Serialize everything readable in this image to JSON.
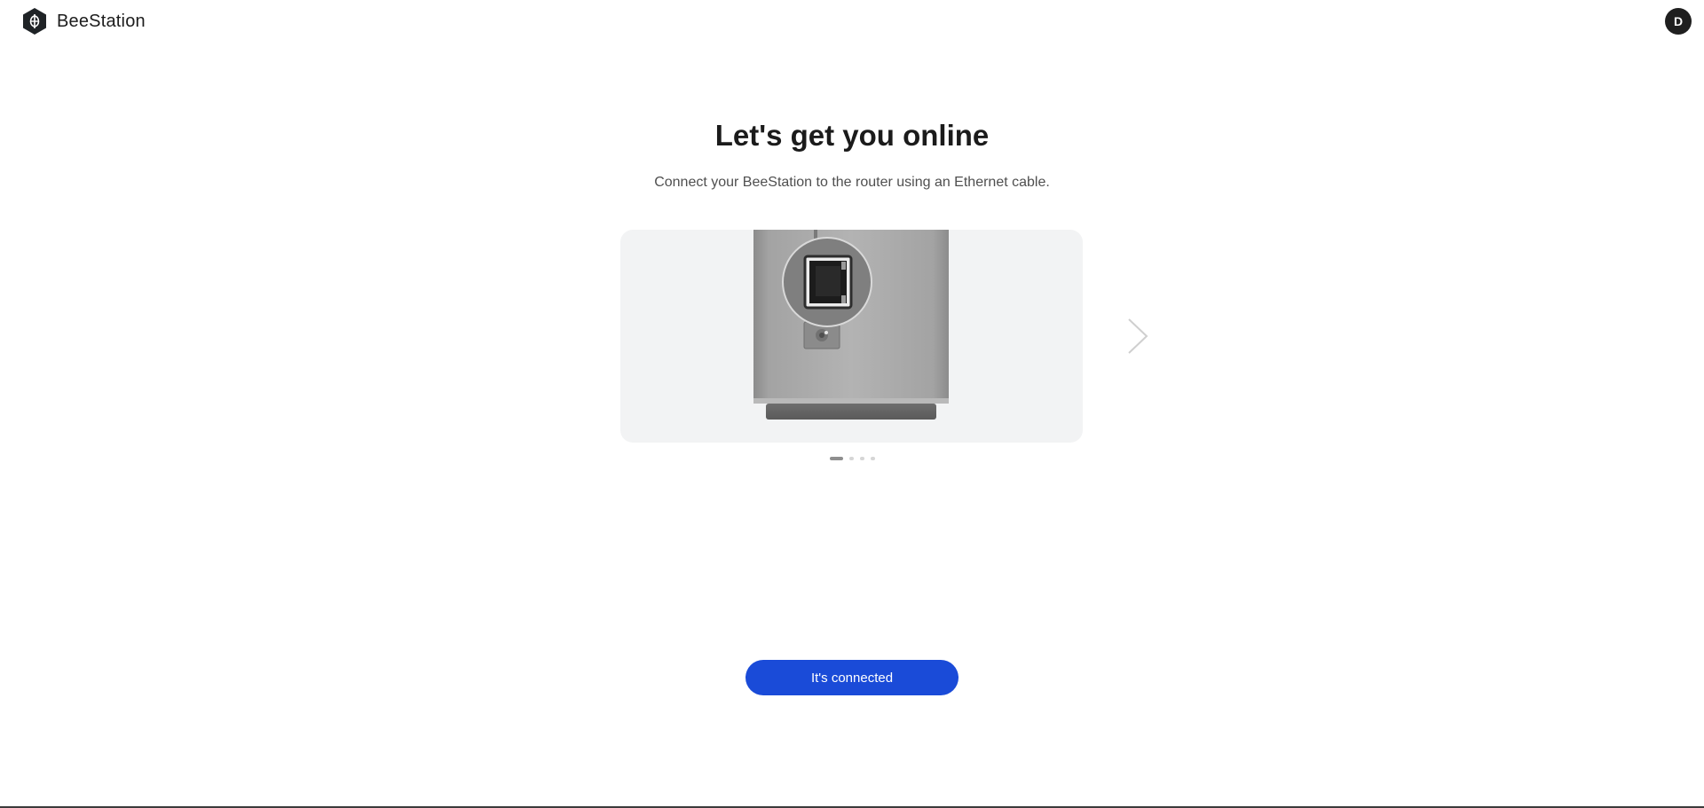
{
  "header": {
    "brand_name": "BeeStation",
    "logo_icon": "beestation-logo-icon",
    "avatar_initial": "D"
  },
  "main": {
    "title": "Let's get you online",
    "subtitle": "Connect your BeeStation to the router using an Ethernet cable.",
    "carousel": {
      "slide_count": 4,
      "active_slide": 1,
      "image": "beestation-ethernet-port-illustration",
      "next_icon": "chevron-right-icon"
    },
    "primary_button_label": "It's connected"
  },
  "colors": {
    "accent": "#1a4bd8",
    "carousel_bg": "#f2f3f4",
    "avatar_bg": "#1f1f1f"
  }
}
